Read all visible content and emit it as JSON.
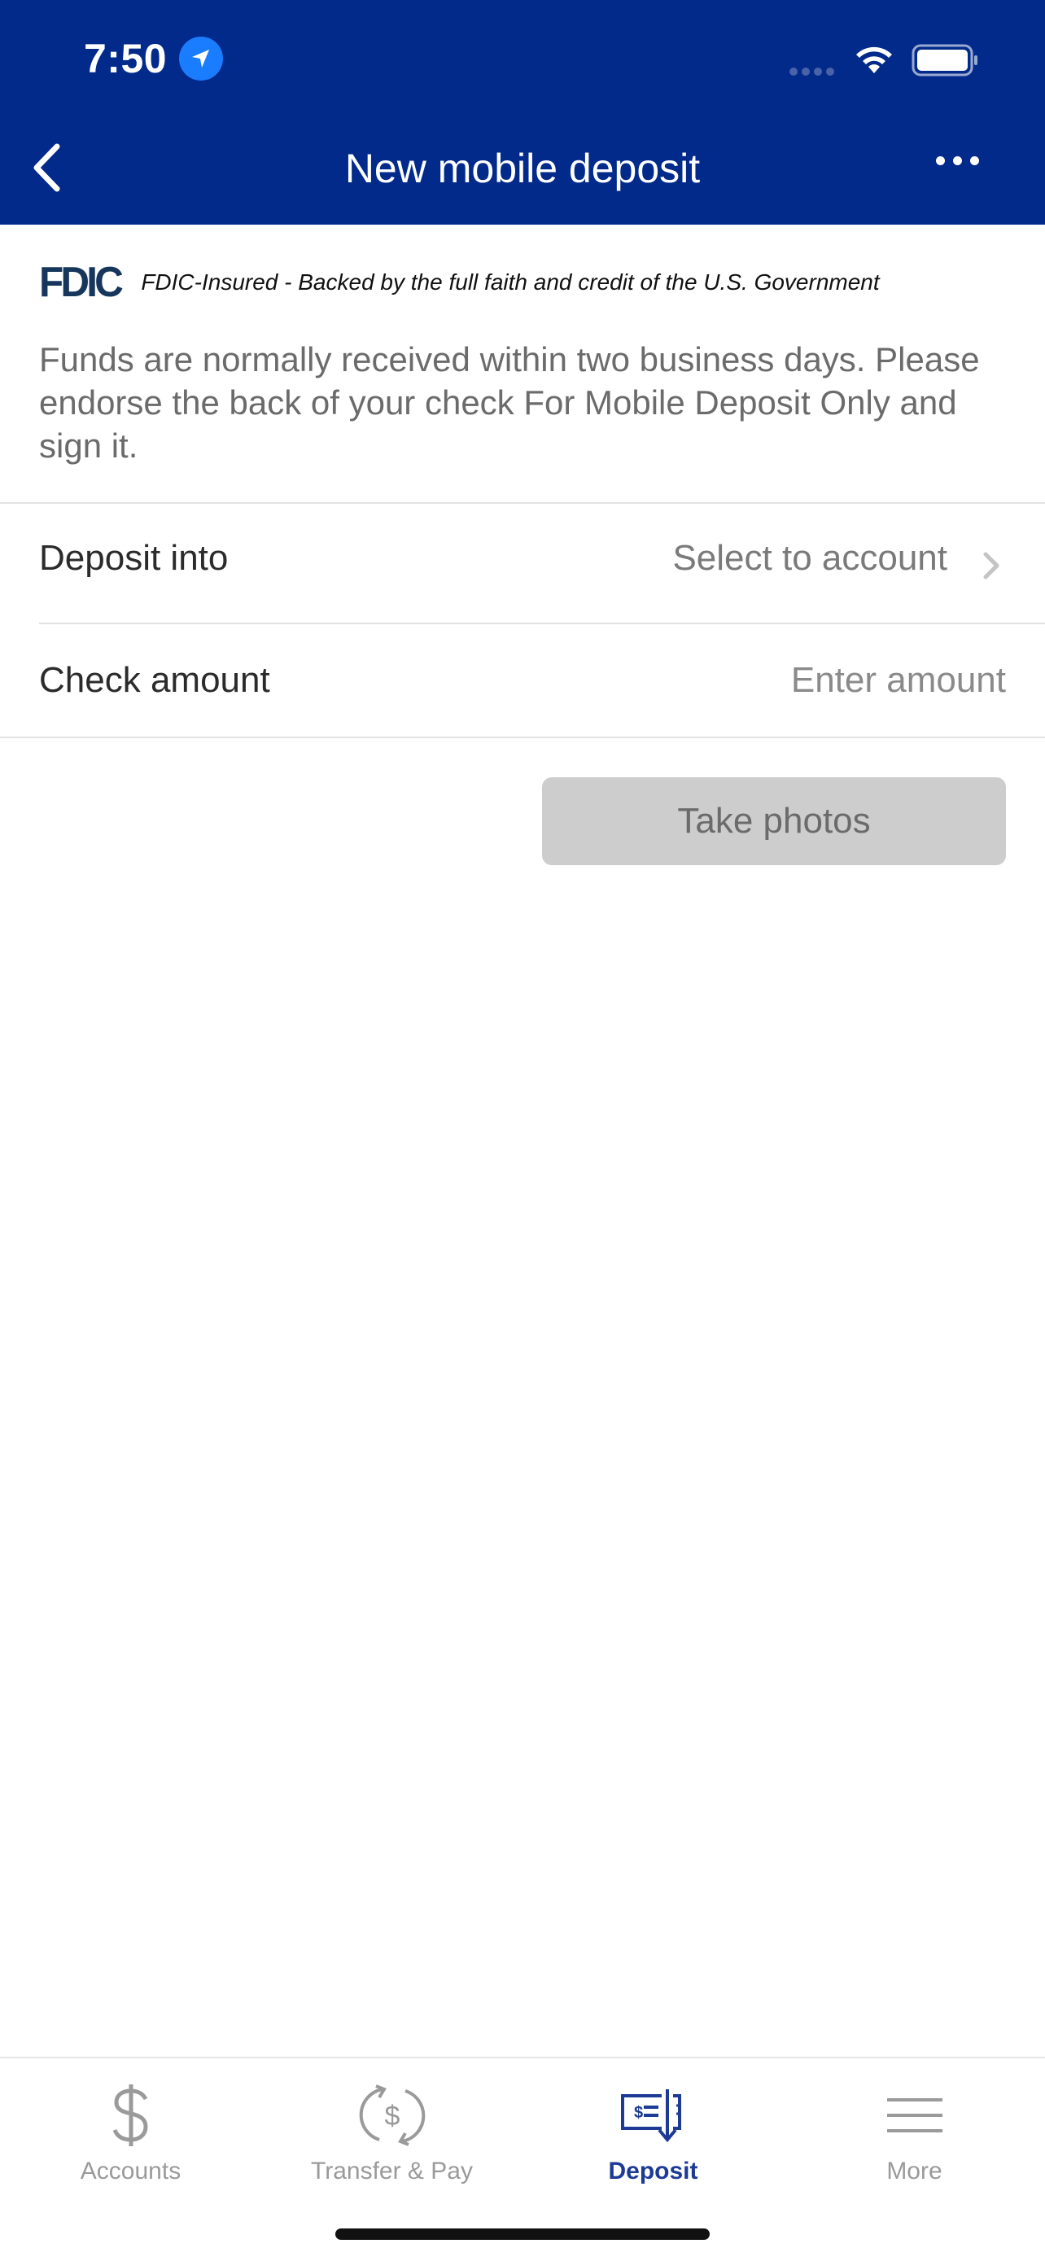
{
  "status_bar": {
    "time": "7:50"
  },
  "header": {
    "title": "New mobile deposit"
  },
  "fdic": {
    "logo": "FDIC",
    "text": "FDIC-Insured - Backed by the full faith and credit of the U.S. Government"
  },
  "info_text": "Funds are normally received within two business days. Please endorse the back of your check For Mobile Deposit Only and sign it.",
  "form": {
    "deposit_into": {
      "label": "Deposit into",
      "value": "Select to account"
    },
    "check_amount": {
      "label": "Check amount",
      "placeholder": "Enter amount"
    }
  },
  "take_photos_label": "Take photos",
  "tabs": [
    {
      "label": "Accounts",
      "icon": "dollar-icon",
      "active": false
    },
    {
      "label": "Transfer & Pay",
      "icon": "transfer-pay-icon",
      "active": false
    },
    {
      "label": "Deposit",
      "icon": "deposit-check-icon",
      "active": true
    },
    {
      "label": "More",
      "icon": "menu-icon",
      "active": false
    }
  ],
  "colors": {
    "header_bg": "#012a8a",
    "active_tab": "#1d3a95",
    "button_disabled": "#cdcdcd"
  }
}
